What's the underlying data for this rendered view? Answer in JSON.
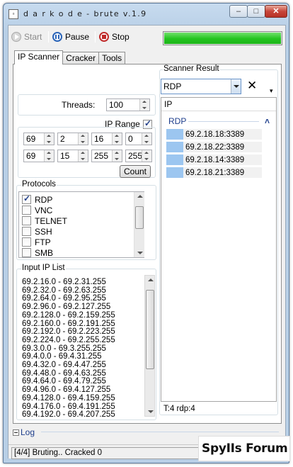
{
  "window": {
    "title": "d a r k o d e - brute v.1.9",
    "min_glyph": "–",
    "max_glyph": "□",
    "close_glyph": "✕"
  },
  "toolbar": {
    "start_label": "Start",
    "pause_label": "Pause",
    "stop_label": "Stop",
    "progress_percent": 100,
    "progress_color": "#23c41f"
  },
  "tabs": [
    {
      "label": "IP Scanner",
      "active": true
    },
    {
      "label": "Cracker",
      "active": false
    },
    {
      "label": "Tools",
      "active": false
    }
  ],
  "scanner": {
    "threads_label": "Threads:",
    "threads_value": "100",
    "ip_range_label": "IP Range",
    "ip_range_checked": true,
    "range_start": [
      "69",
      "2",
      "16",
      "0"
    ],
    "range_end": [
      "69",
      "15",
      "255",
      "255"
    ],
    "count_label": "Count"
  },
  "protocols": {
    "title": "Protocols",
    "items": [
      {
        "label": "RDP",
        "checked": true
      },
      {
        "label": "VNC",
        "checked": false
      },
      {
        "label": "TELNET",
        "checked": false
      },
      {
        "label": "SSH",
        "checked": false
      },
      {
        "label": "FTP",
        "checked": false
      },
      {
        "label": "SMB",
        "checked": false
      }
    ]
  },
  "ip_list": {
    "title": "Input IP List",
    "rows": [
      "69.2.16.0 - 69.2.31.255",
      "69.2.32.0 - 69.2.63.255",
      "69.2.64.0 - 69.2.95.255",
      "69.2.96.0 - 69.2.127.255",
      "69.2.128.0 - 69.2.159.255",
      "69.2.160.0 - 69.2.191.255",
      "69.2.192.0 - 69.2.223.255",
      "69.2.224.0 - 69.2.255.255",
      "69.3.0.0 - 69.3.255.255",
      "69.4.0.0 - 69.4.31.255",
      "69.4.32.0 - 69.4.47.255",
      "69.4.48.0 - 69.4.63.255",
      "69.4.64.0 - 69.4.79.255",
      "69.4.96.0 - 69.4.127.255",
      "69.4.128.0 - 69.4.159.255",
      "69.4.176.0 - 69.4.191.255",
      "69.4.192.0 - 69.4.207.255"
    ]
  },
  "result": {
    "title": "Scanner Result",
    "filter_value": "RDP",
    "clear_glyph": "✕",
    "menu_glyph": "▾",
    "column_header": "IP",
    "group_label": "RDP",
    "group_glyph": "˄",
    "items": [
      "69.2.18.18:3389",
      "69.2.18.22:3389",
      "69.2.18.14:3389",
      "69.2.18.21:3389"
    ],
    "status": "T:4 rdp:4"
  },
  "log": {
    "label": "Log"
  },
  "statusbar": {
    "text": "[4/4] Bruting.. Cracked 0"
  },
  "watermark": {
    "text": "SpyIIs Forum"
  }
}
